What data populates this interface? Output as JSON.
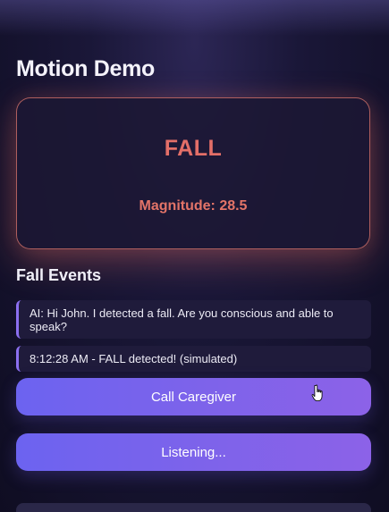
{
  "header": {
    "title": "Motion Demo"
  },
  "status": {
    "state": "FALL",
    "magnitude": "Magnitude: 28.5",
    "accent": "#e36f68"
  },
  "events": {
    "title": "Fall Events",
    "items": [
      "AI: Hi John. I detected a fall. Are you conscious and able to speak?",
      "8:12:28 AM - FALL detected! (simulated)"
    ]
  },
  "actions": {
    "call_label": "Call Caregiver",
    "listen_label": "Listening..."
  },
  "colors": {
    "button_start": "#6c63f0",
    "button_end": "#8c62e8",
    "event_accent": "#8b6ff0"
  },
  "cursor": {
    "icon": "hand-pointer-icon"
  }
}
